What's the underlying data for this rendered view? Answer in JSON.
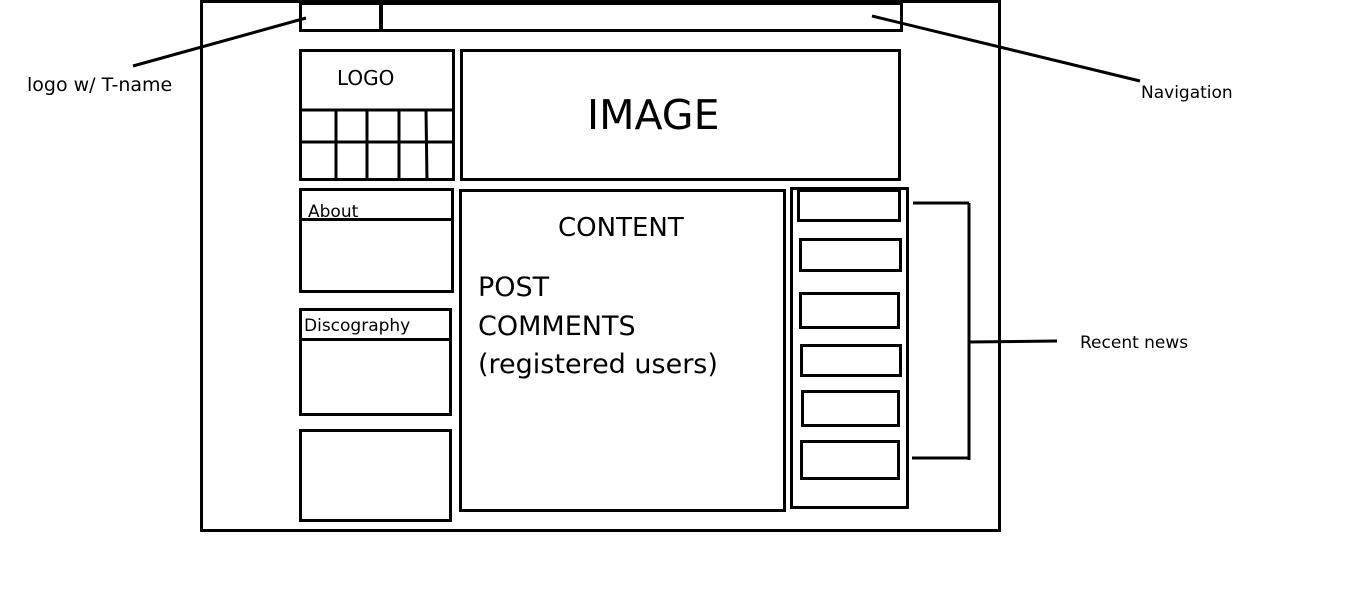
{
  "annotations": {
    "logo_note": "logo w/ T-name",
    "navigation_note": "Navigation",
    "recent_news_note": "Recent news"
  },
  "wireframe": {
    "logo": "LOGO",
    "image": "IMAGE",
    "about": "About",
    "discography": "Discography",
    "content": {
      "title": "CONTENT",
      "lines": [
        "POST",
        "COMMENTS",
        "(registered users)"
      ]
    },
    "news_item_count": 6
  }
}
